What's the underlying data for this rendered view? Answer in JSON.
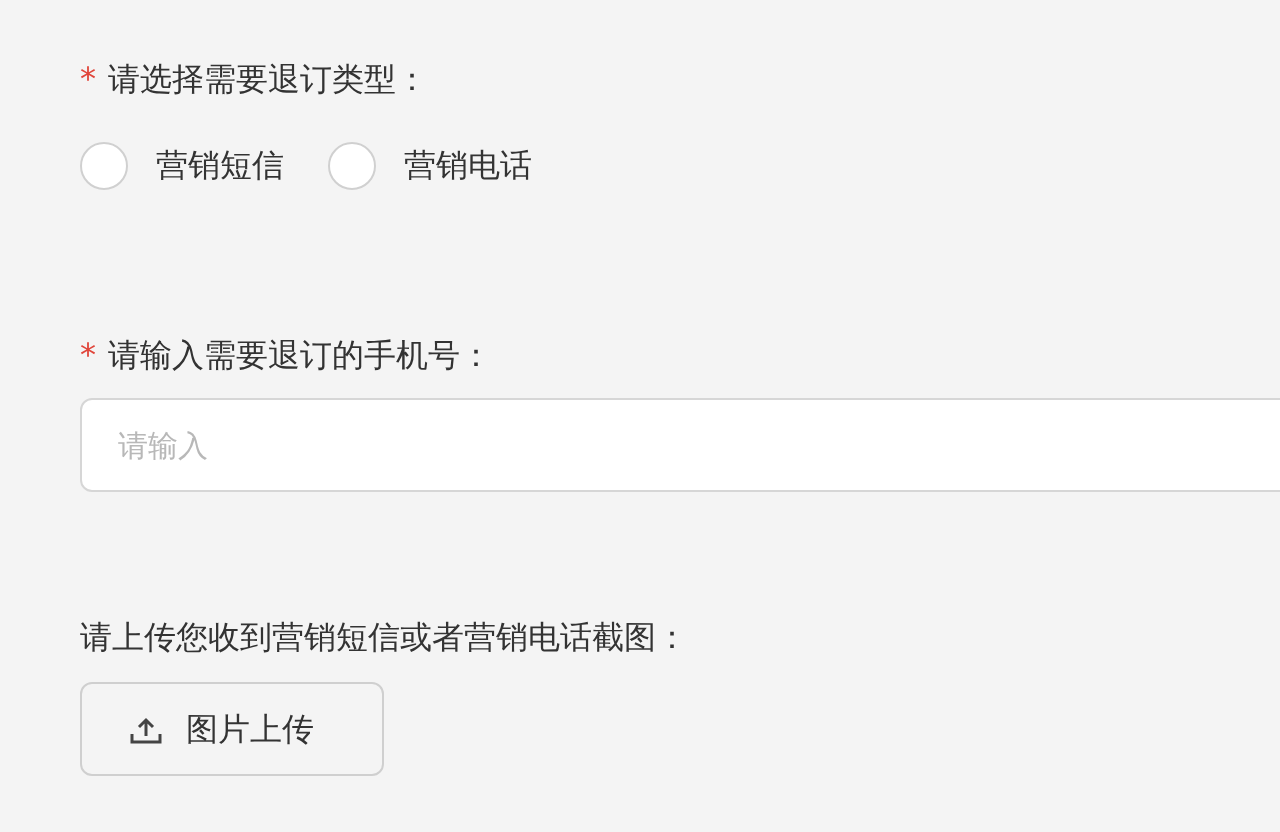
{
  "unsubscribe_type": {
    "required_mark": "*",
    "label": "请选择需要退订类型：",
    "options": [
      {
        "label": "营销短信",
        "selected": false
      },
      {
        "label": "营销电话",
        "selected": false
      }
    ]
  },
  "phone": {
    "required_mark": "*",
    "label": "请输入需要退订的手机号：",
    "placeholder": "请输入"
  },
  "screenshot": {
    "label": "请上传您收到营销短信或者营销电话截图：",
    "button": "图片上传"
  }
}
